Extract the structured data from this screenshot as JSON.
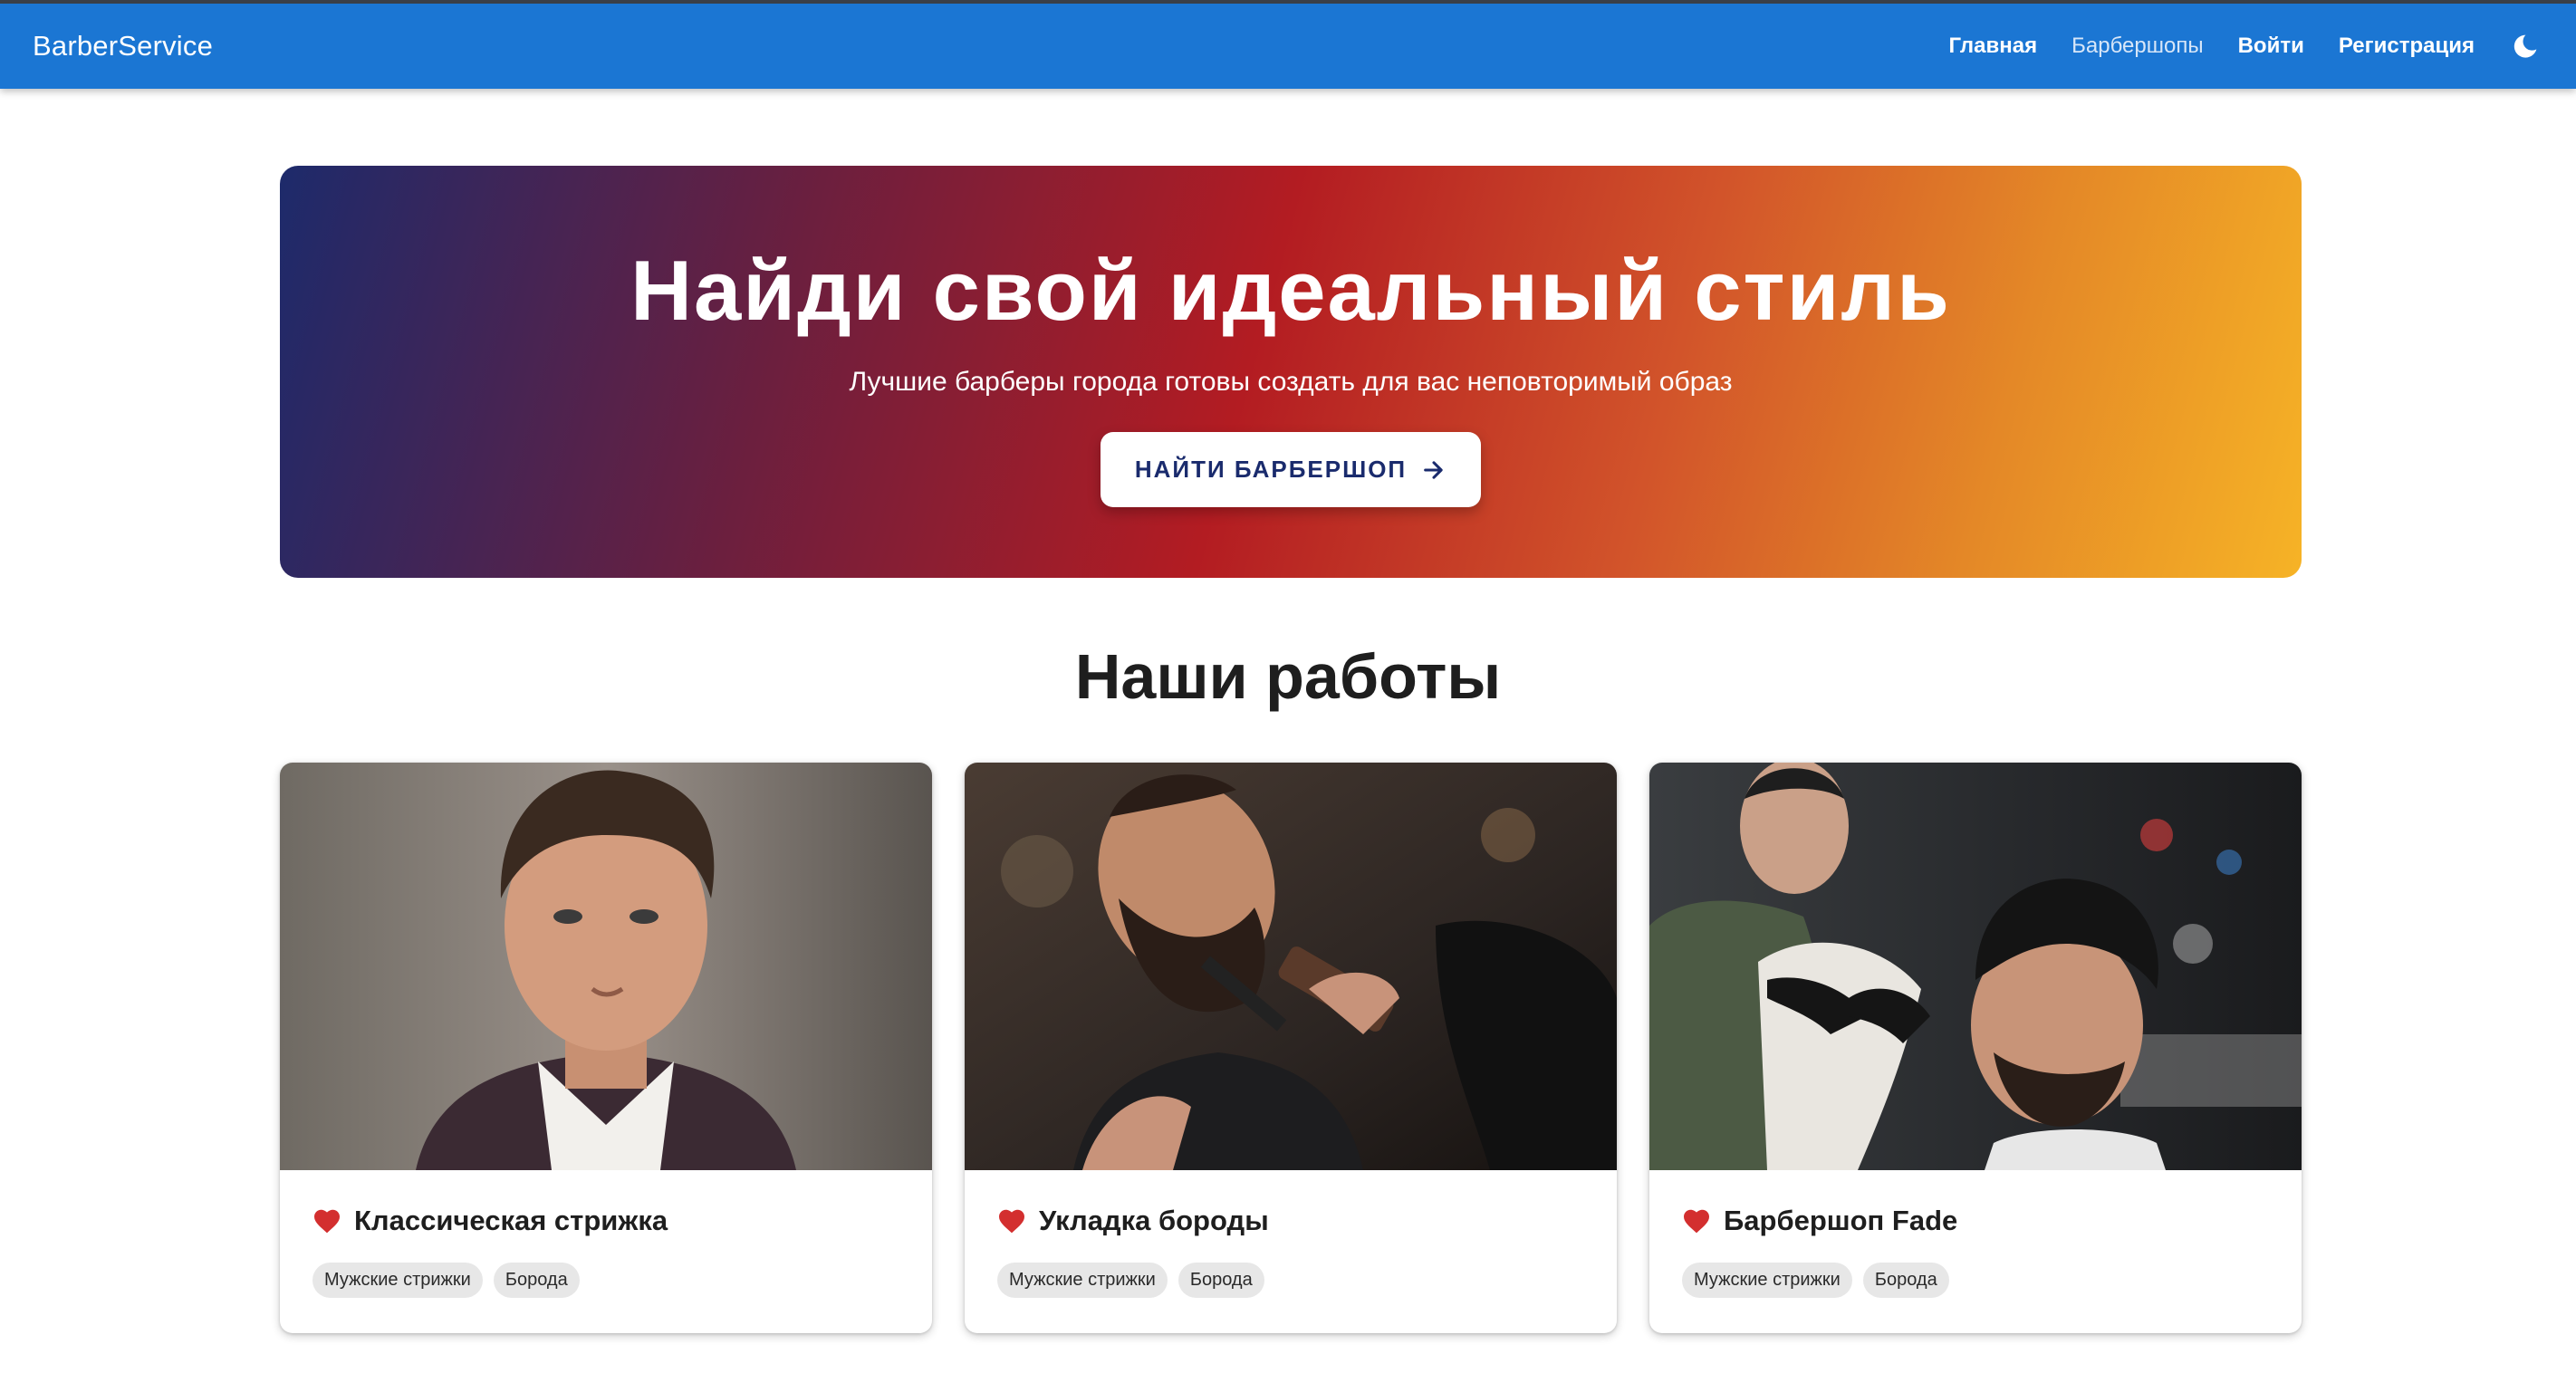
{
  "appbar": {
    "brand": "BarberService",
    "nav": [
      {
        "label": "Главная"
      },
      {
        "label": "Барбершопы"
      },
      {
        "label": "Войти"
      },
      {
        "label": "Регистрация"
      }
    ],
    "theme_icon": "moon-icon",
    "color": "#1b76d3"
  },
  "hero": {
    "title": "Найди свой идеальный стиль",
    "subtitle": "Лучшие барберы города готовы создать для вас неповторимый образ",
    "button_label": "НАЙТИ БАРБЕРШОП",
    "button_icon": "arrow-right-icon",
    "gradient": [
      "#1d2a6b",
      "#b31c22",
      "#f6b326"
    ]
  },
  "works": {
    "title": "Наши работы",
    "cards": [
      {
        "title": "Классическая стрижка",
        "tags": [
          "Мужские стрижки",
          "Борода"
        ],
        "icon": "heart-icon"
      },
      {
        "title": "Укладка бороды",
        "tags": [
          "Мужские стрижки",
          "Борода"
        ],
        "icon": "heart-icon"
      },
      {
        "title": "Барбершоп Fade",
        "tags": [
          "Мужские стрижки",
          "Борода"
        ],
        "icon": "heart-icon"
      }
    ]
  },
  "colors": {
    "heart": "#d32f2f",
    "chip_bg": "#e7e7e7"
  }
}
